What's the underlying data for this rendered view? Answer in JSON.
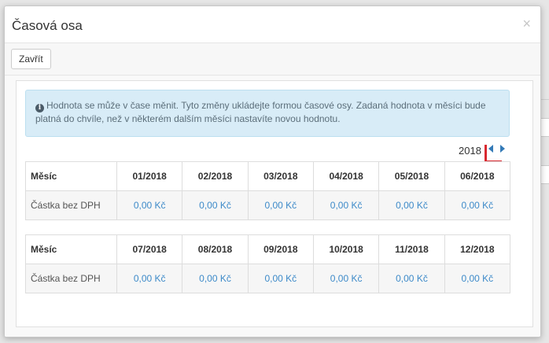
{
  "modal": {
    "title": "Časová osa",
    "close_symbol": "×",
    "close_button_label": "Zavřít"
  },
  "alert": {
    "icon": "info-circle-icon",
    "text": "Hodnota se může v čase měnit. Tyto změny ukládejte formou časové osy. Zadaná hodnota v měsíci bude platná do chvíle, než v některém dalším měsíci nastavíte novou hodnotu."
  },
  "year_nav": {
    "year": "2018",
    "prev_icon": "caret-left-icon",
    "next_icon": "caret-right-icon"
  },
  "table1": {
    "header_label": "Měsíc",
    "row_label": "Částka bez DPH",
    "months": [
      "01/2018",
      "02/2018",
      "03/2018",
      "04/2018",
      "05/2018",
      "06/2018"
    ],
    "values": [
      "0,00 Kč",
      "0,00 Kč",
      "0,00 Kč",
      "0,00 Kč",
      "0,00 Kč",
      "0,00 Kč"
    ]
  },
  "table2": {
    "header_label": "Měsíc",
    "row_label": "Částka bez DPH",
    "months": [
      "07/2018",
      "08/2018",
      "09/2018",
      "10/2018",
      "11/2018",
      "12/2018"
    ],
    "values": [
      "0,00 Kč",
      "0,00 Kč",
      "0,00 Kč",
      "0,00 Kč",
      "0,00 Kč",
      "0,00 Kč"
    ]
  },
  "colors": {
    "accent": "#337ab7",
    "value_text": "#3d8ac9",
    "alert_bg": "#d8ecf7",
    "annotation_red": "#d9282f"
  }
}
